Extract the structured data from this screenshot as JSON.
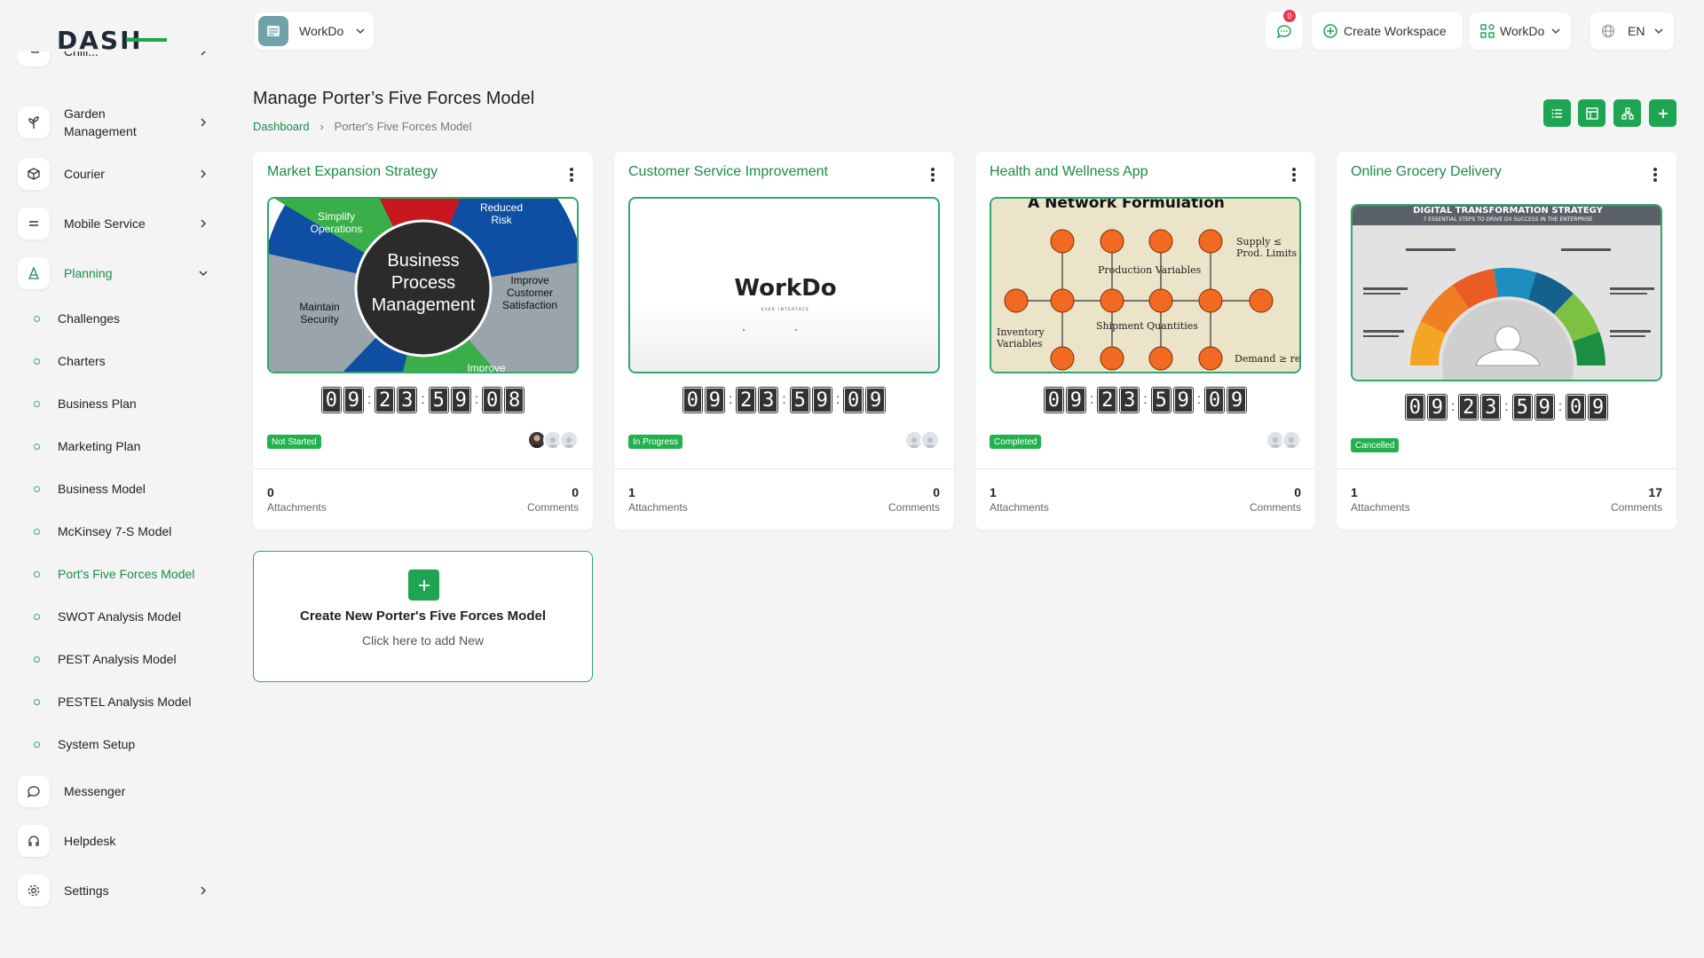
{
  "colors": {
    "brand": "#1da552",
    "brand_text": "#1b8b4a",
    "background": "#f4f4f5"
  },
  "logo": {
    "text": "DASH"
  },
  "sidebar": {
    "items": [
      {
        "label": "Chill...",
        "icon": "cart-icon"
      },
      {
        "label": "Garden Management",
        "icon": "plant-icon",
        "chevron": true
      },
      {
        "label": "Courier",
        "icon": "box-icon",
        "chevron": true
      },
      {
        "label": "Mobile Service",
        "icon": "menu-icon",
        "chevron": true
      },
      {
        "label": "Planning",
        "icon": "planning-icon",
        "chevron": true,
        "expanded": true
      },
      {
        "label": "Messenger",
        "icon": "chat-icon"
      },
      {
        "label": "Helpdesk",
        "icon": "headset-icon"
      },
      {
        "label": "Settings",
        "icon": "gear-icon",
        "chevron": true
      }
    ],
    "planning_sub": [
      "Challenges",
      "Charters",
      "Business Plan",
      "Marketing Plan",
      "Business Model",
      "McKinsey 7-S Model",
      "Port's Five Forces Model",
      "SWOT Analysis Model",
      "PEST Analysis Model",
      "PESTEL Analysis Model",
      "System Setup"
    ],
    "active_sub": "Port's Five Forces Model"
  },
  "topbar": {
    "workspace": "WorkDo",
    "notifications": "0",
    "create_workspace": "Create Workspace",
    "workspace_menu": "WorkDo",
    "language": "EN"
  },
  "page": {
    "title": "Manage Porter’s Five Forces Model",
    "breadcrumb": {
      "home": "Dashboard",
      "current": "Porter's Five Forces Model"
    }
  },
  "cards": [
    {
      "title": "Market Expansion Strategy",
      "image": "business-process-management",
      "timer": [
        "0",
        "9",
        "2",
        "3",
        "5",
        "9",
        "0",
        "8"
      ],
      "status": "Not Started",
      "attachments": "0",
      "attachments_label": "Attachments",
      "comments": "0",
      "comments_label": "Comments",
      "img_text": {
        "center1": "Business",
        "center2": "Process",
        "center3": "Management",
        "a": "Simplify",
        "a2": "Operations",
        "b": "Reduced",
        "b2": "Risk",
        "c": "Improve",
        "c2": "Customer",
        "c3": "Satisfaction",
        "d": "Maintain",
        "d2": "Security",
        "e": "Improve"
      }
    },
    {
      "title": "Customer Service Improvement",
      "image": "workdo-logo",
      "timer": [
        "0",
        "9",
        "2",
        "3",
        "5",
        "9",
        "0",
        "9"
      ],
      "status": "In Progress",
      "attachments": "1",
      "attachments_label": "Attachments",
      "comments": "0",
      "comments_label": "Comments",
      "img_text": {
        "brand": "WorkDo",
        "tag": "USER INTERFACE"
      }
    },
    {
      "title": "Health and Wellness App",
      "image": "network-formulation",
      "timer": [
        "0",
        "9",
        "2",
        "3",
        "5",
        "9",
        "0",
        "9"
      ],
      "status": "Completed",
      "attachments": "1",
      "attachments_label": "Attachments",
      "comments": "0",
      "comments_label": "Comments",
      "img_text": {
        "heading": "A Network Formulation",
        "pv": "Production Variables",
        "sq": "Shipment Quantities",
        "iv": "Inventory",
        "iv2": "Variables",
        "sl": "Supply ≤",
        "sl2": "Prod. Limits",
        "dr": "Demand ≥ req"
      }
    },
    {
      "title": "Online Grocery Delivery",
      "image": "digital-transformation",
      "timer": [
        "0",
        "9",
        "2",
        "3",
        "5",
        "9",
        "0",
        "9"
      ],
      "status": "Cancelled",
      "attachments": "1",
      "attachments_label": "Attachments",
      "comments": "17",
      "comments_label": "Comments",
      "img_text": {
        "heading": "DIGITAL TRANSFORMATION STRATEGY",
        "sub": "7 ESSENTIAL STEPS TO DRIVE DX SUCCESS IN THE ENTERPRISE"
      }
    }
  ],
  "create_card": {
    "title": "Create New Porter's Five Forces Model",
    "subtitle": "Click here to add New"
  }
}
